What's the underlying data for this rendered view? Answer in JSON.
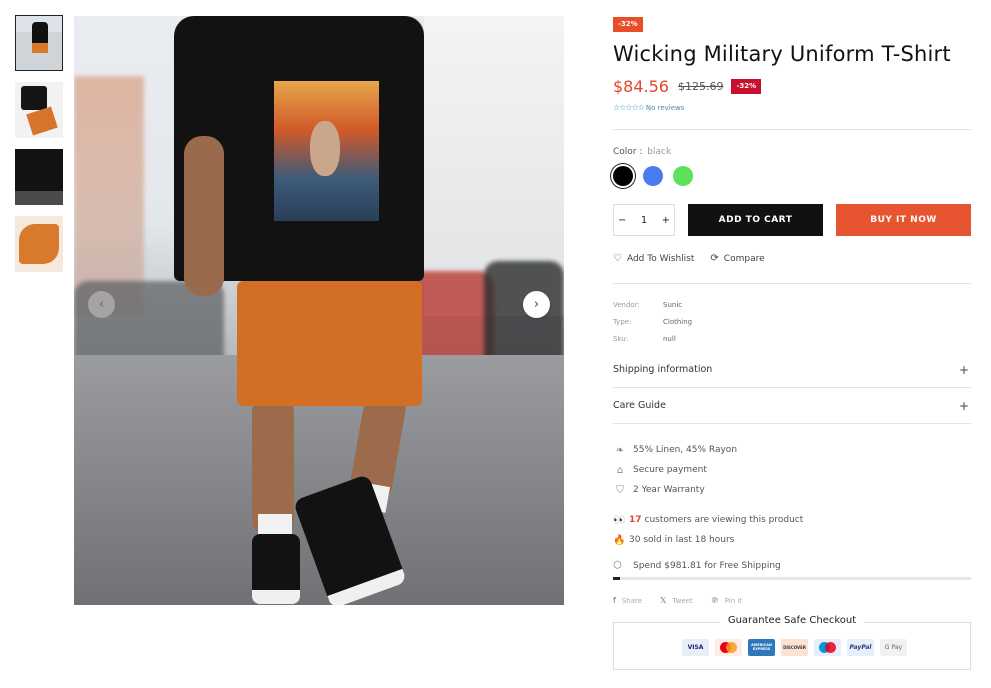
{
  "product": {
    "discount_badge": "-32%",
    "title": "Wicking Military Uniform T-Shirt",
    "price": "$84.56",
    "old_price": "$125.69",
    "price_badge": "-32%",
    "stars": "☆☆☆☆☆",
    "reviews": "No reviews"
  },
  "color": {
    "label": "Color :",
    "value": "black",
    "swatches": [
      {
        "name": "black",
        "hex": "#000000"
      },
      {
        "name": "blue",
        "hex": "#4a7cf0"
      },
      {
        "name": "green",
        "hex": "#5ee05a"
      }
    ]
  },
  "quantity": {
    "minus": "−",
    "value": "1",
    "plus": "+"
  },
  "buttons": {
    "add_to_cart": "ADD TO CART",
    "buy_now": "BUY IT NOW"
  },
  "actions": {
    "wishlist": "Add To Wishlist",
    "compare": "Compare"
  },
  "meta": {
    "vendor_label": "Vendor:",
    "vendor": "Sunic",
    "type_label": "Type:",
    "type": "Clothing",
    "sku_label": "Sku:",
    "sku": "null"
  },
  "accordions": {
    "shipping": "Shipping information",
    "care": "Care Guide",
    "expand": "+"
  },
  "features": {
    "material": "55% Linen, 45% Rayon",
    "payment": "Secure payment",
    "warranty": "2 Year Warranty"
  },
  "live": {
    "viewers_count": "17",
    "viewers_text": "customers are viewing this product",
    "sold_text": "30 sold in last 18 hours"
  },
  "shipping": {
    "text": "Spend $981.81 for Free Shipping",
    "progress": 0.02
  },
  "share": {
    "facebook": "Share",
    "twitter": "Tweet",
    "pinterest": "Pin it"
  },
  "checkout": {
    "title": "Guarantee Safe Checkout",
    "cards": {
      "visa": "VISA",
      "mastercard": "",
      "amex": "AMERICAN EXPRESS",
      "discover": "DISCOVER",
      "maestro": "",
      "paypal": "PayPal",
      "gpay": "G Pay"
    }
  },
  "colors": {
    "accent": "#e94d2a",
    "buy_button": "#e6552f",
    "sale_badge": "#c8102e",
    "cart_button": "#111111"
  }
}
